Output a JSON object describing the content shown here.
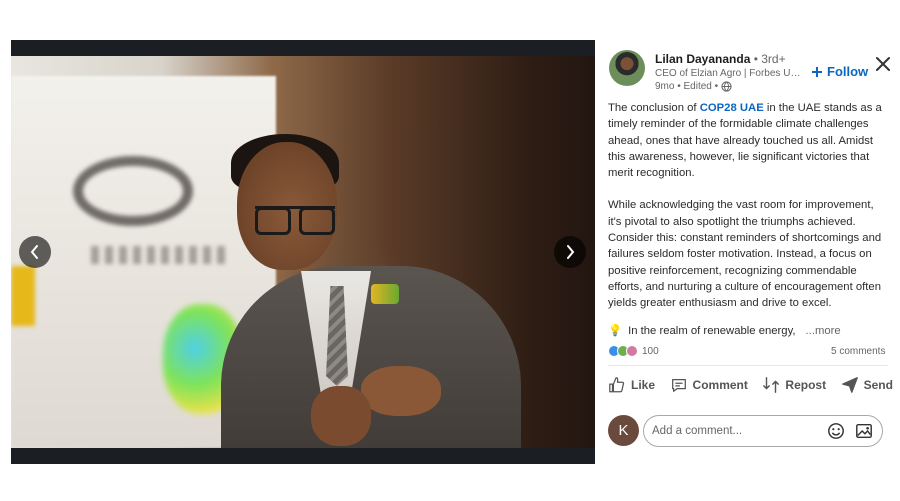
{
  "author": {
    "name": "Lilan Dayananda",
    "degree": " • 3rd+",
    "headline": "CEO of Elzian Agro | Forbes Unde...",
    "meta": "9mo • Edited • ",
    "follow_label": "Follow"
  },
  "post": {
    "p1_before": "The conclusion of ",
    "p1_hashtag": "COP28 UAE",
    "p1_after": " in the UAE stands as a timely reminder of the formidable climate challenges ahead, ones that have already touched us all. Amidst this awareness, however, lie significant victories that merit recognition.",
    "p2": "While acknowledging the vast room for improvement, it's pivotal to also spotlight the triumphs achieved. Consider this: constant reminders of shortcomings and failures seldom foster motivation. Instead, a focus on positive reinforcement, recognizing commendable efforts, and nurturing a culture of encouragement often yields greater enthusiasm and drive to excel.",
    "teaser_emoji": "💡",
    "teaser": "In the realm of renewable energy,",
    "more_label": "...more"
  },
  "stats": {
    "reactions_count": "100",
    "comments_count": "5 comments"
  },
  "actions": {
    "like": "Like",
    "comment": "Comment",
    "repost": "Repost",
    "send": "Send"
  },
  "comment_box": {
    "avatar_initial": "K",
    "placeholder": "Add a comment..."
  },
  "colors": {
    "accent": "#0a66c2",
    "media_bg": "#1b1f23"
  },
  "icons": {
    "prev": "chevron-left-icon",
    "next": "chevron-right-icon",
    "close": "close-icon",
    "globe": "globe-icon",
    "plus": "plus-icon",
    "like": "thumbs-up-icon",
    "comment": "comment-bubble-icon",
    "repost": "repost-arrows-icon",
    "send": "send-paper-plane-icon",
    "emoji": "emoji-icon",
    "image": "image-icon"
  }
}
